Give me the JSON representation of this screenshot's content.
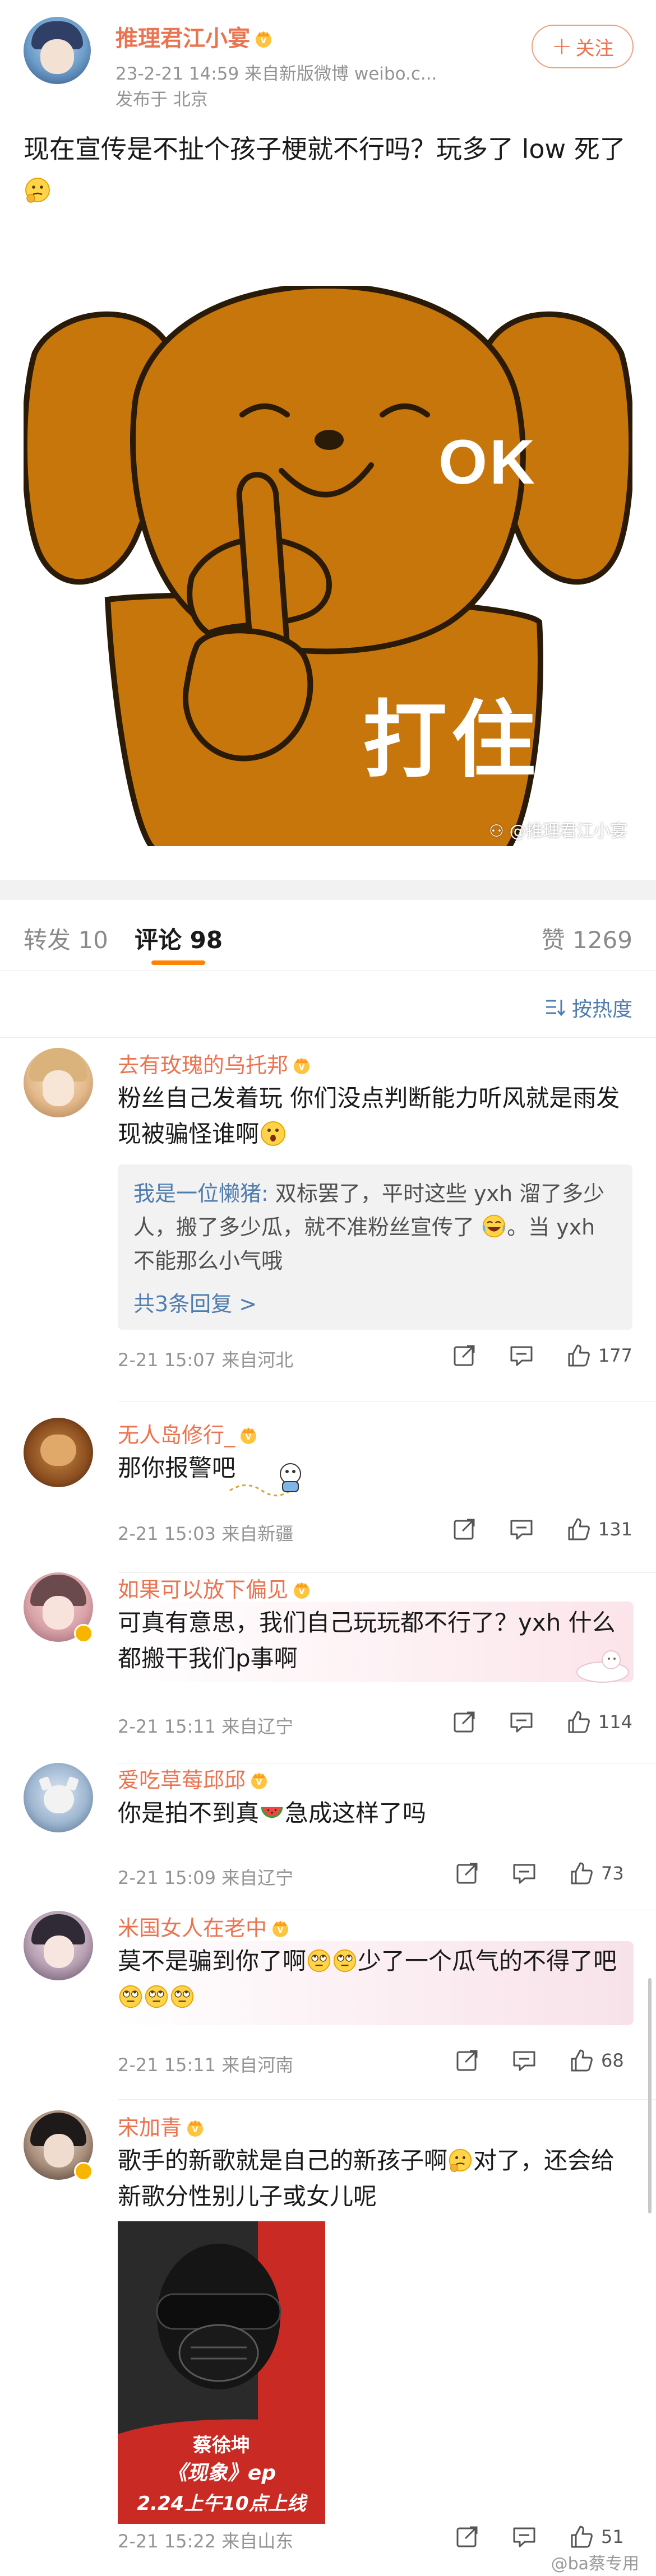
{
  "post": {
    "author": "推理君江小宴",
    "meta_line": "23-2-21 14:59 来自新版微博 weibo.c...",
    "location": "发布于 北京",
    "follow_label": "关注",
    "text": "现在宣传是不扯个孩子梗就不行吗？玩多了 low 死了",
    "image": {
      "text_ok": "OK",
      "text_cn": "打住",
      "watermark": "@推理君江小宴"
    }
  },
  "tabs": {
    "repost": "转发 10",
    "comment": "评论 98",
    "like": "赞 1269"
  },
  "sort_label": "按热度",
  "comments": [
    {
      "name": "去有玫瑰的乌托邦",
      "text": "粉丝自己发着玩 你们没点判断能力听风就是雨发现被骗怪谁啊",
      "reply_author": "我是一位懒猪:",
      "reply_text": " 双标罢了，平时这些 yxh 溜了多少人，搬了多少瓜，就不准粉丝宣传了",
      "reply_text2": "。当 yxh 不能那么小气哦",
      "reply_more": "共3条回复 >",
      "time": "2-21 15:07  来自河北",
      "likes": "177"
    },
    {
      "name": "无人岛修行_",
      "text": "那你报警吧",
      "time": "2-21 15:03  来自新疆",
      "likes": "131"
    },
    {
      "name": "如果可以放下偏见",
      "text": "可真有意思，我们自己玩玩都不行了？yxh 什么都搬干我们p事啊",
      "time": "2-21 15:11  来自辽宁",
      "likes": "114"
    },
    {
      "name": "爱吃草莓邱邱",
      "text": "你是拍不到真",
      "text2": "急成这样了吗",
      "time": "2-21 15:09  来自辽宁",
      "likes": "73"
    },
    {
      "name": "米国女人在老中",
      "text": "莫不是骗到你了啊",
      "text2": "少了一个瓜气的不得了吧",
      "time": "2-21 15:11  来自河南",
      "likes": "68"
    },
    {
      "name": "宋加青",
      "text": "歌手的新歌就是自己的新孩子啊",
      "text2": "对了，还会给新歌分性别儿子或女儿呢",
      "album": {
        "artist": "蔡徐坤",
        "title": "《现象》ep",
        "date": "2.24上午10点上线"
      },
      "time": "2-21 15:22  来自山东",
      "likes": "51"
    }
  ],
  "footer_watermark": "@ba蔡专用",
  "colors": {
    "accent_orange": "#eb7350",
    "link_blue": "#507daf",
    "tab_indicator": "#ff8200",
    "dog_fur": "#c7760c"
  }
}
